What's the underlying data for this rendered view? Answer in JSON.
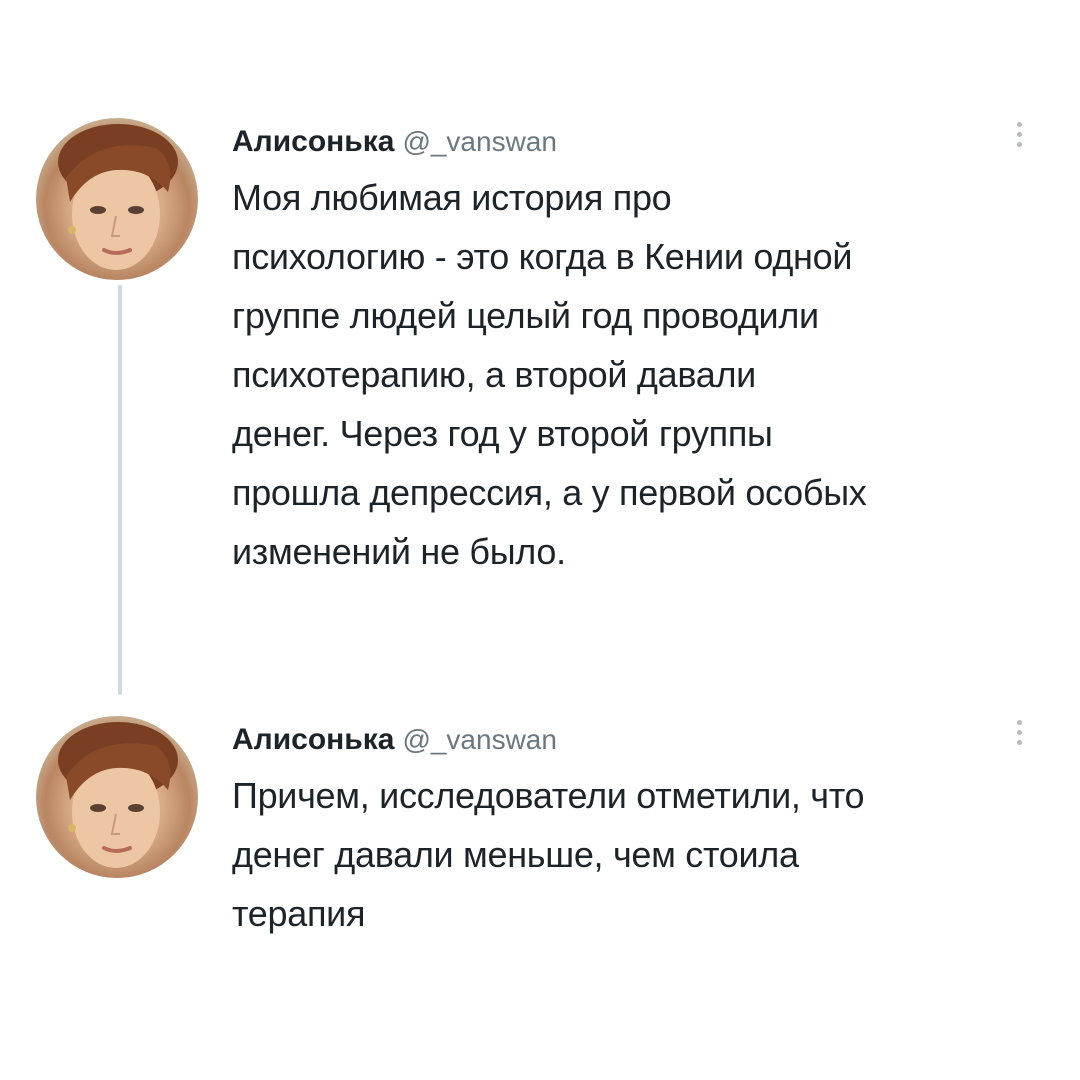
{
  "thread": [
    {
      "author_name": "Алисонька",
      "author_handle": "@_vanswan",
      "text": "Моя любимая история про\nпсихологию - это когда в Кении одной\nгруппе людей целый год проводили\nпсихотерапию, а второй давали\nденег. Через год у второй группы\nпрошла депрессия, а у первой особых\nизменений не было."
    },
    {
      "author_name": "Алисонька",
      "author_handle": "@_vanswan",
      "text": "Причем, исследователи отметили, что\nденег давали меньше, чем стоила\nтерапия"
    }
  ],
  "icons": {
    "more": "more-vertical-icon",
    "avatar": "avatar"
  },
  "colors": {
    "text": "#1d2429",
    "handle": "#6b7780",
    "thread_line": "#cfd9de",
    "more_dots": "#b3bcc2"
  }
}
